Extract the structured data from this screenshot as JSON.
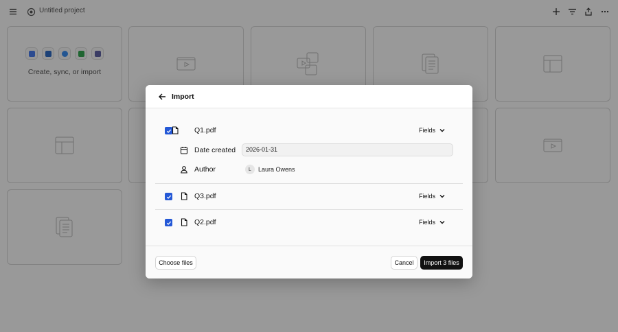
{
  "app": {
    "project_title": "Untitled project"
  },
  "background": {
    "create_card_text": "Create, sync, or import"
  },
  "modal": {
    "title": "Import",
    "files": [
      {
        "name": "Q1.pdf",
        "checked": true,
        "fields_label": "Fields",
        "properties": [
          {
            "icon": "calendar-icon",
            "label": "Date created",
            "value": "2026-01-31"
          },
          {
            "icon": "person-icon",
            "label": "Author",
            "avatar_initial": "L",
            "value": "Laura Owens"
          }
        ]
      },
      {
        "name": "Q3.pdf",
        "checked": true,
        "fields_label": "Fields"
      },
      {
        "name": "Q2.pdf",
        "checked": true,
        "fields_label": "Fields"
      }
    ],
    "footer": {
      "choose_files_label": "Choose files",
      "cancel_label": "Cancel",
      "import_label": "Import 3 files"
    }
  },
  "colors": {
    "checkbox": "#2458d6",
    "primary_button": "#111111",
    "overlay": "rgba(0,0,0,0.40)"
  }
}
